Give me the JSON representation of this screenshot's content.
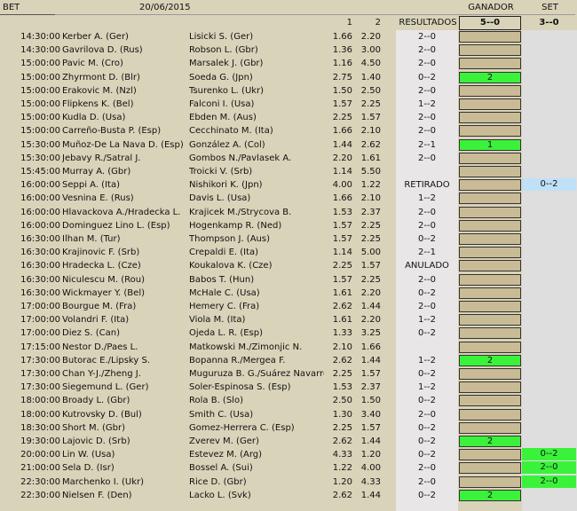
{
  "header": {
    "bet_label": "BET",
    "date": "20/06/2015",
    "ganador_label": "GANADOR",
    "set_label": "SET",
    "col1_label": "1",
    "col2_label": "2",
    "resultados_label": "RESULTADOS",
    "ganador_score": "5--0",
    "set_score": "3--0"
  },
  "colors": {
    "background": "#d9d3b9",
    "highlight_green": "#3bf23b",
    "highlight_blue": "#bfe0f7",
    "ganador_box": "#c9bb95"
  },
  "rows": [
    {
      "time": "14:30:00",
      "p1": "Kerber A. (Ger)",
      "p2": "Lisicki S. (Ger)",
      "o1": "1.66",
      "o2": "2.20",
      "res": "2--0",
      "gan": "",
      "set": "",
      "set_style": ""
    },
    {
      "time": "14:30:00",
      "p1": "Gavrilova D. (Rus)",
      "p2": "Robson L. (Gbr)",
      "o1": "1.36",
      "o2": "3.00",
      "res": "2--0",
      "gan": "",
      "set": "",
      "set_style": ""
    },
    {
      "time": "15:00:00",
      "p1": "Pavic M. (Cro)",
      "p2": "Marsalek J. (Gbr)",
      "o1": "1.16",
      "o2": "4.50",
      "res": "2--0",
      "gan": "",
      "set": "",
      "set_style": ""
    },
    {
      "time": "15:00:00",
      "p1": "Zhyrmont D. (Blr)",
      "p2": "Soeda G. (Jpn)",
      "o1": "2.75",
      "o2": "1.40",
      "res": "0--2",
      "gan": "2",
      "set": "",
      "set_style": ""
    },
    {
      "time": "15:00:00",
      "p1": "Erakovic M. (Nzl)",
      "p2": "Tsurenko L. (Ukr)",
      "o1": "1.50",
      "o2": "2.50",
      "res": "2--0",
      "gan": "",
      "set": "",
      "set_style": ""
    },
    {
      "time": "15:00:00",
      "p1": "Flipkens K. (Bel)",
      "p2": "Falconi I. (Usa)",
      "o1": "1.57",
      "o2": "2.25",
      "res": "1--2",
      "gan": "",
      "set": "",
      "set_style": ""
    },
    {
      "time": "15:00:00",
      "p1": "Kudla D. (Usa)",
      "p2": "Ebden M. (Aus)",
      "o1": "2.25",
      "o2": "1.57",
      "res": "2--0",
      "gan": "",
      "set": "",
      "set_style": ""
    },
    {
      "time": "15:00:00",
      "p1": "Carreño-Busta P. (Esp)",
      "p2": "Cecchinato M. (Ita)",
      "o1": "1.66",
      "o2": "2.10",
      "res": "2--0",
      "gan": "",
      "set": "",
      "set_style": ""
    },
    {
      "time": "15:30:00",
      "p1": "Muñoz-De La Nava D. (Esp)",
      "p2": "González A. (Col)",
      "o1": "1.44",
      "o2": "2.62",
      "res": "2--1",
      "gan": "1",
      "set": "",
      "set_style": ""
    },
    {
      "time": "15:30:00",
      "p1": "Jebavy R./Satral J.",
      "p2": "Gombos N./Pavlasek A.",
      "o1": "2.20",
      "o2": "1.61",
      "res": "2--0",
      "gan": "",
      "set": "",
      "set_style": ""
    },
    {
      "time": "15:45:00",
      "p1": "Murray A. (Gbr)",
      "p2": "Troicki V. (Srb)",
      "o1": "1.14",
      "o2": "5.50",
      "res": "",
      "gan": "",
      "set": "",
      "set_style": ""
    },
    {
      "time": "16:00:00",
      "p1": "Seppi A. (Ita)",
      "p2": "Nishikori K. (Jpn)",
      "o1": "4.00",
      "o2": "1.22",
      "res": "RETIRADO",
      "gan": "",
      "set": "0--2",
      "set_style": "blue"
    },
    {
      "time": "16:00:00",
      "p1": "Vesnina E. (Rus)",
      "p2": "Davis L. (Usa)",
      "o1": "1.66",
      "o2": "2.10",
      "res": "1--2",
      "gan": "",
      "set": "",
      "set_style": ""
    },
    {
      "time": "16:00:00",
      "p1": "Hlavackova A./Hradecka L.",
      "p2": "Krajicek M./Strycova B.",
      "o1": "1.53",
      "o2": "2.37",
      "res": "2--0",
      "gan": "",
      "set": "",
      "set_style": ""
    },
    {
      "time": "16:00:00",
      "p1": "Dominguez Lino L. (Esp)",
      "p2": "Hogenkamp R. (Ned)",
      "o1": "1.57",
      "o2": "2.25",
      "res": "2--0",
      "gan": "",
      "set": "",
      "set_style": ""
    },
    {
      "time": "16:30:00",
      "p1": "Ilhan M. (Tur)",
      "p2": "Thompson J. (Aus)",
      "o1": "1.57",
      "o2": "2.25",
      "res": "0--2",
      "gan": "",
      "set": "",
      "set_style": ""
    },
    {
      "time": "16:30:00",
      "p1": "Krajinovic F. (Srb)",
      "p2": "Crepaldi E. (Ita)",
      "o1": "1.14",
      "o2": "5.00",
      "res": "2--1",
      "gan": "",
      "set": "",
      "set_style": ""
    },
    {
      "time": "16:30:00",
      "p1": "Hradecka L. (Cze)",
      "p2": "Koukalova K. (Cze)",
      "o1": "2.25",
      "o2": "1.57",
      "res": "ANULADO",
      "gan": "",
      "set": "",
      "set_style": ""
    },
    {
      "time": "16:30:00",
      "p1": "Niculescu M. (Rou)",
      "p2": "Babos T. (Hun)",
      "o1": "1.57",
      "o2": "2.25",
      "res": "2--0",
      "gan": "",
      "set": "",
      "set_style": ""
    },
    {
      "time": "16:30:00",
      "p1": "Wickmayer Y. (Bel)",
      "p2": "McHale C. (Usa)",
      "o1": "1.61",
      "o2": "2.20",
      "res": "0--2",
      "gan": "",
      "set": "",
      "set_style": ""
    },
    {
      "time": "17:00:00",
      "p1": "Bourgue M. (Fra)",
      "p2": "Hemery C. (Fra)",
      "o1": "2.62",
      "o2": "1.44",
      "res": "2--0",
      "gan": "",
      "set": "",
      "set_style": ""
    },
    {
      "time": "17:00:00",
      "p1": "Volandri F. (Ita)",
      "p2": "Viola M. (Ita)",
      "o1": "1.61",
      "o2": "2.20",
      "res": "1--2",
      "gan": "",
      "set": "",
      "set_style": ""
    },
    {
      "time": "17:00:00",
      "p1": "Diez S. (Can)",
      "p2": "Ojeda L. R. (Esp)",
      "o1": "1.33",
      "o2": "3.25",
      "res": "0--2",
      "gan": "",
      "set": "",
      "set_style": ""
    },
    {
      "time": "17:15:00",
      "p1": "Nestor D./Paes L.",
      "p2": "Matkowski M./Zimonjic N.",
      "o1": "2.10",
      "o2": "1.66",
      "res": "",
      "gan": "",
      "set": "",
      "set_style": ""
    },
    {
      "time": "17:30:00",
      "p1": "Butorac E./Lipsky S.",
      "p2": "Bopanna R./Mergea F.",
      "o1": "2.62",
      "o2": "1.44",
      "res": "1--2",
      "gan": "2",
      "set": "",
      "set_style": ""
    },
    {
      "time": "17:30:00",
      "p1": "Chan Y-J./Zheng J.",
      "p2": "Muguruza B. G./Suárez Navarro C.",
      "o1": "2.25",
      "o2": "1.57",
      "res": "0--2",
      "gan": "",
      "set": "",
      "set_style": ""
    },
    {
      "time": "17:30:00",
      "p1": "Siegemund L. (Ger)",
      "p2": "Soler-Espinosa S. (Esp)",
      "o1": "1.53",
      "o2": "2.37",
      "res": "1--2",
      "gan": "",
      "set": "",
      "set_style": ""
    },
    {
      "time": "18:00:00",
      "p1": "Broady L. (Gbr)",
      "p2": "Rola B. (Slo)",
      "o1": "2.50",
      "o2": "1.50",
      "res": "0--2",
      "gan": "",
      "set": "",
      "set_style": ""
    },
    {
      "time": "18:00:00",
      "p1": "Kutrovsky D. (Bul)",
      "p2": "Smith C. (Usa)",
      "o1": "1.30",
      "o2": "3.40",
      "res": "2--0",
      "gan": "",
      "set": "",
      "set_style": ""
    },
    {
      "time": "18:30:00",
      "p1": "Short M. (Gbr)",
      "p2": "Gomez-Herrera C. (Esp)",
      "o1": "2.25",
      "o2": "1.57",
      "res": "0--2",
      "gan": "",
      "set": "",
      "set_style": ""
    },
    {
      "time": "19:30:00",
      "p1": "Lajovic D. (Srb)",
      "p2": "Zverev M. (Ger)",
      "o1": "2.62",
      "o2": "1.44",
      "res": "0--2",
      "gan": "2",
      "set": "",
      "set_style": ""
    },
    {
      "time": "20:00:00",
      "p1": "Lin W. (Usa)",
      "p2": "Estevez M. (Arg)",
      "o1": "4.33",
      "o2": "1.20",
      "res": "0--2",
      "gan": "",
      "set": "0--2",
      "set_style": "green"
    },
    {
      "time": "21:00:00",
      "p1": "Sela D. (Isr)",
      "p2": "Bossel A. (Sui)",
      "o1": "1.22",
      "o2": "4.00",
      "res": "2--0",
      "gan": "",
      "set": "2--0",
      "set_style": "green"
    },
    {
      "time": "22:30:00",
      "p1": "Marchenko I. (Ukr)",
      "p2": "Rice D. (Gbr)",
      "o1": "1.20",
      "o2": "4.33",
      "res": "2--0",
      "gan": "",
      "set": "2--0",
      "set_style": "green"
    },
    {
      "time": "22:30:00",
      "p1": "Nielsen F. (Den)",
      "p2": "Lacko L. (Svk)",
      "o1": "2.62",
      "o2": "1.44",
      "res": "0--2",
      "gan": "2",
      "set": "",
      "set_style": ""
    }
  ]
}
